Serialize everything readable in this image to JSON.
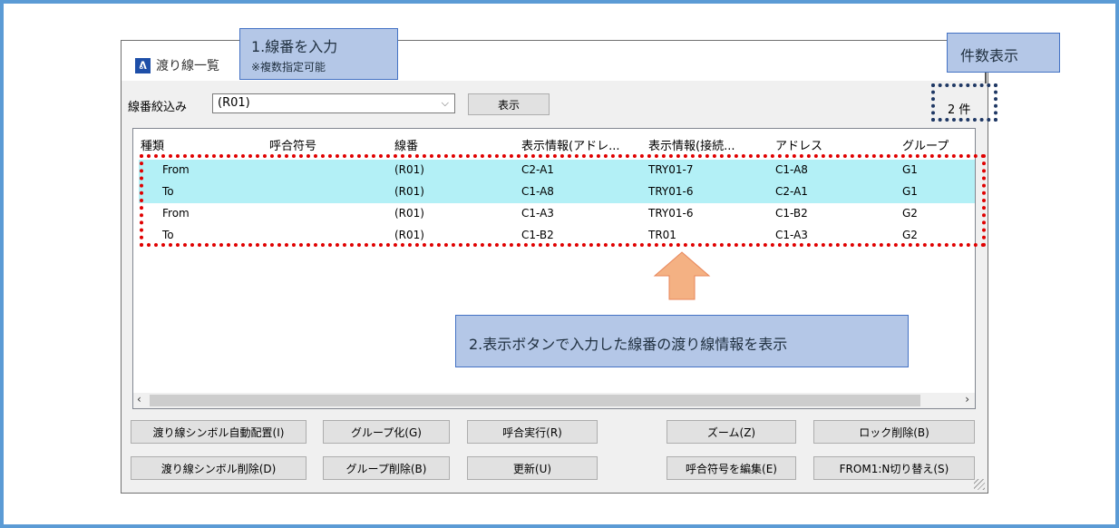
{
  "window": {
    "title": "渡り線一覧",
    "icon": "app-logo-icon"
  },
  "filter": {
    "label": "線番絞込み",
    "value": "(R01)",
    "show_button": "表示"
  },
  "count": {
    "value": "2",
    "unit": "件"
  },
  "columns": [
    "種類",
    "呼合符号",
    "線番",
    "表示情報(アドレ...",
    "表示情報(接続...",
    "アドレス",
    "グループ"
  ],
  "rows": [
    {
      "type": "From",
      "code": "",
      "wire": "(R01)",
      "disp_addr": "C2-A1",
      "disp_conn": "TRY01-7",
      "address": "C1-A8",
      "group": "G1",
      "selected": true
    },
    {
      "type": "To",
      "code": "",
      "wire": "(R01)",
      "disp_addr": "C1-A8",
      "disp_conn": "TRY01-6",
      "address": "C2-A1",
      "group": "G1",
      "selected": true
    },
    {
      "type": "From",
      "code": "",
      "wire": "(R01)",
      "disp_addr": "C1-A3",
      "disp_conn": "TRY01-6",
      "address": "C1-B2",
      "group": "G2",
      "selected": false
    },
    {
      "type": "To",
      "code": "",
      "wire": "(R01)",
      "disp_addr": "C1-B2",
      "disp_conn": "TR01",
      "address": "C1-A3",
      "group": "G2",
      "selected": false
    }
  ],
  "buttons": {
    "auto_place": "渡り線シンボル自動配置(I)",
    "delete_symbol": "渡り線シンボル削除(D)",
    "group": "グループ化(G)",
    "ungroup": "グループ削除(B)",
    "call_exec": "呼合実行(R)",
    "refresh": "更新(U)",
    "zoom": "ズーム(Z)",
    "edit_code": "呼合符号を編集(E)",
    "unlock": "ロック削除(B)",
    "switch": "FROM1:N切り替え(S)"
  },
  "annotations": {
    "step1_title": "1.線番を入力",
    "step1_note": "※複数指定可能",
    "count_label": "件数表示",
    "step2": "2.表示ボタンで入力した線番の渡り線情報を表示"
  },
  "colors": {
    "frame": "#5b9bd5",
    "selected_row": "#b3f0f6",
    "callout_fill": "#b4c7e7",
    "highlight_red": "#e00000",
    "highlight_navy": "#1f3864",
    "arrow": "#f4b183"
  }
}
